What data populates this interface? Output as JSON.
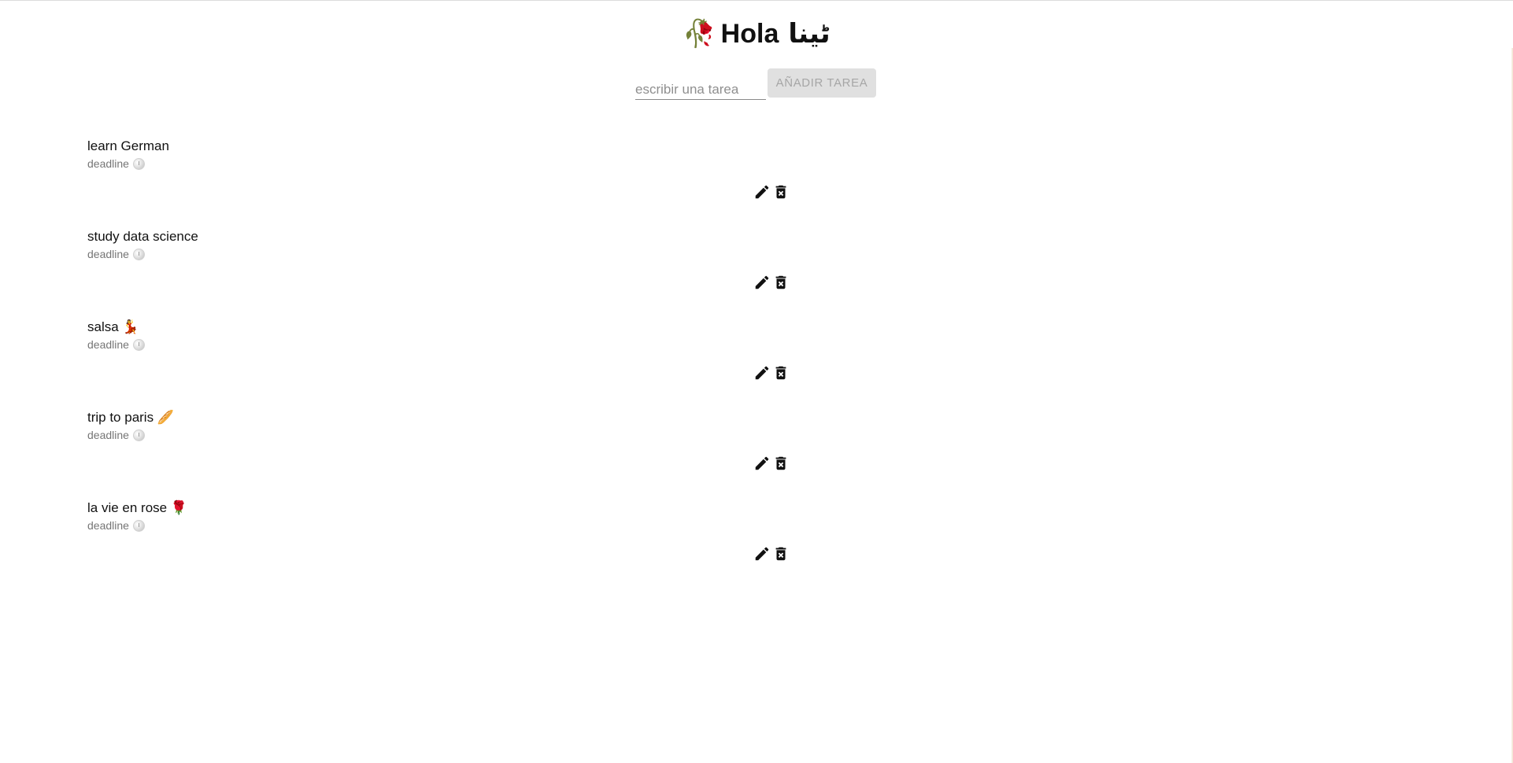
{
  "header": {
    "wilted_emoji": "🥀",
    "greeting": "Hola",
    "name": "ٹینا"
  },
  "add_task": {
    "input_value": "",
    "placeholder": "escribir una tarea",
    "button_label": "AÑADIR TAREA"
  },
  "tasks": [
    {
      "text": "learn German",
      "deadline_label": "deadline"
    },
    {
      "text": "study data science",
      "deadline_label": "deadline"
    },
    {
      "text": "salsa 💃",
      "deadline_label": "deadline"
    },
    {
      "text": "trip to paris 🥖",
      "deadline_label": "deadline"
    },
    {
      "text": "la vie en rose 🌹",
      "deadline_label": "deadline"
    }
  ],
  "icons": {
    "edit": "pencil-icon",
    "delete": "delete-forever-icon",
    "deadline": "clock-icon"
  }
}
